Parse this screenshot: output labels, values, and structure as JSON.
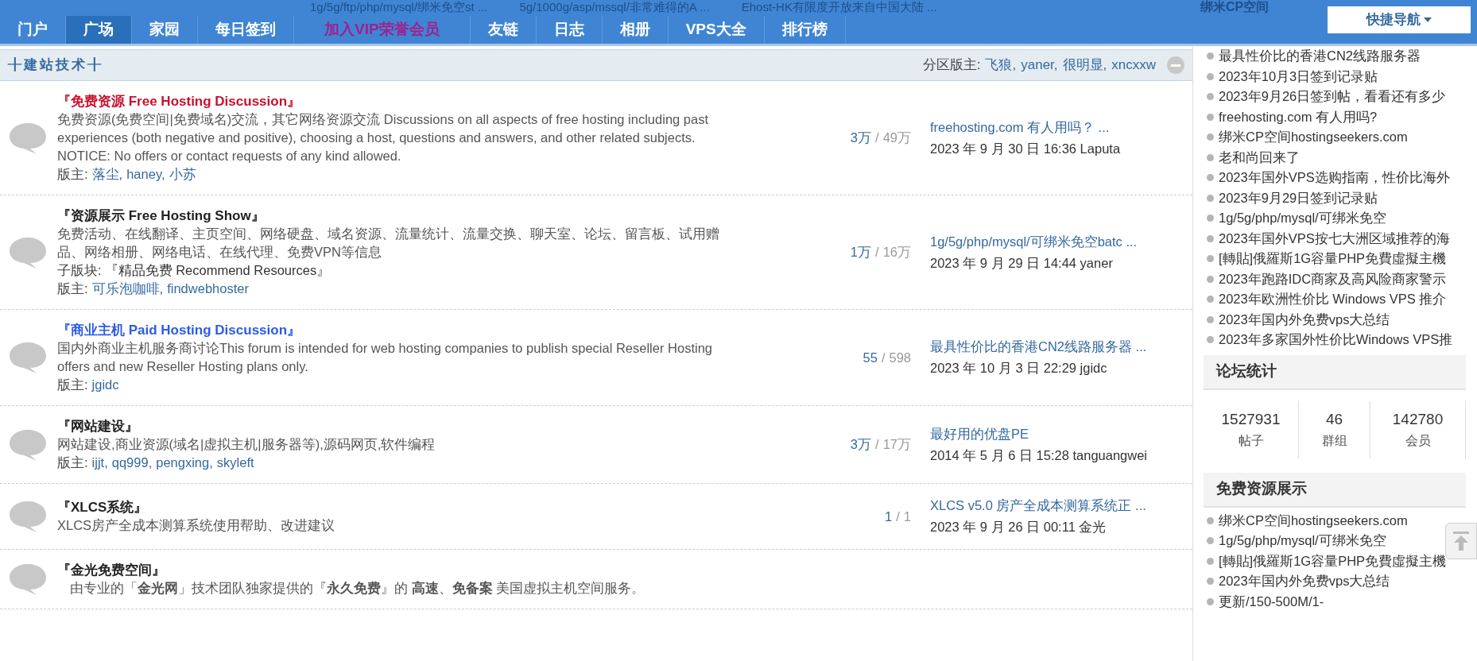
{
  "background_links": [
    "1g/5g/ftp/php/mysql/绑米免空st ...",
    "5g/1000g/asp/mssql/非常难得的A ...",
    "Ehost-HK有限度开放来自中国大陆 ..."
  ],
  "background_panel_title": "绑米CP空间",
  "nav": [
    {
      "label": "门户",
      "selected": false,
      "kind": "normal"
    },
    {
      "label": "广场",
      "selected": true,
      "kind": "normal"
    },
    {
      "label": "家园",
      "selected": false,
      "kind": "normal"
    },
    {
      "label": "每日签到",
      "selected": false,
      "kind": "normal"
    },
    {
      "label": "加入VIP荣誉会员",
      "selected": false,
      "kind": "vip"
    },
    {
      "label": "友链",
      "selected": false,
      "kind": "normal"
    },
    {
      "label": "日志",
      "selected": false,
      "kind": "normal"
    },
    {
      "label": "相册",
      "selected": false,
      "kind": "normal"
    },
    {
      "label": "VPS大全",
      "selected": false,
      "kind": "normal"
    },
    {
      "label": "排行榜",
      "selected": false,
      "kind": "normal"
    }
  ],
  "quick_nav": "快捷导航",
  "section": {
    "title": "╂建站技术╂",
    "moderators_label": "分区版主:",
    "moderators": [
      "飞狼,",
      "yaner,",
      "很明显,",
      "xncxxw"
    ],
    "collapsed": false
  },
  "forums": [
    {
      "title": "『免费资源 Free Hosting Discussion』",
      "color": "#c8102e",
      "description": "免费资源(免费空间|免费域名)交流，其它网络资源交流 Discussions on all aspects of free hosting including past experiences (both negative and positive), choosing a host, questions and answers, and other related subjects. NOTICE: No offers or contact requests of any kind allowed.",
      "moderators_label": "版主:",
      "moderators": [
        "落尘,",
        "haney,",
        "小苏"
      ],
      "threads": "3万",
      "separator": "/",
      "posts": "49万",
      "last_topic": "freehosting.com 有人用吗？ ...",
      "last_info": "2023 年 9 月 30 日 16:36 Laputa"
    },
    {
      "title": "『资源展示 Free Hosting Show』",
      "color": "#222222",
      "description": "免费活动、在线翻译、主页空间、网络硬盘、域名资源、流量统计、流量交换、聊天室、论坛、留言板、试用赠品、网络相册、网络电话、在线代理、免费VPN等信息",
      "subforum_label": "子版块:",
      "subforum": "『精品免费 Recommend Resources』",
      "moderators_label": "版主:",
      "moderators": [
        "可乐泡咖啡,",
        "findwebhoster"
      ],
      "threads": "1万",
      "separator": "/",
      "posts": "16万",
      "last_topic": "1g/5g/php/mysql/可绑米免空batc ...",
      "last_info": "2023 年 9 月 29 日 14:44 yaner"
    },
    {
      "title": "『商业主机 Paid Hosting Discussion』",
      "color": "#2b5bea",
      "description": "国内外商业主机服务商讨论This forum is intended for web hosting companies to publish special Reseller Hosting offers and new Reseller Hosting plans only.",
      "moderators_label": "版主:",
      "moderators": [
        "jgidc"
      ],
      "threads": "55",
      "separator": "/",
      "posts": "598",
      "last_topic": "最具性价比的香港CN2线路服务器 ...",
      "last_info": "2023 年 10 月 3 日 22:29 jgidc"
    },
    {
      "title": "『网站建设』",
      "color": "#222222",
      "description": "网站建设,商业资源(域名|虚拟主机|服务器等),源码网页,软件编程",
      "moderators_label": "版主:",
      "moderators": [
        "ijjt,",
        "qq999,",
        "pengxing,",
        "skyleft"
      ],
      "threads": "3万",
      "separator": "/",
      "posts": "17万",
      "last_topic": "最好用的优盘PE",
      "last_info": "2014 年 5 月 6 日 15:28 tanguangwei"
    },
    {
      "title": "『XLCS系统』",
      "color": "#222222",
      "description": "XLCS房产全成本测算系统使用帮助、改进建议",
      "threads": "1",
      "separator": "/",
      "posts": "1",
      "last_topic": "XLCS v5.0 房产全成本测算系统正 ...",
      "last_info": "2023 年 9 月 26 日 00:11 金光"
    },
    {
      "title": "『金光免费空间』",
      "color": "#222222",
      "description": "由专业的「**金光网**」技术团队独家提供的『**永久免费**』的 **高速**、**免备案** 美国虚拟主机空间服务。"
    }
  ],
  "sidebar": {
    "hot_links": [
      "最具性价比的香港CN2线路服务器",
      "2023年10月3日签到记录贴",
      "2023年9月26日签到帖，看看还有多少",
      "freehosting.com 有人用吗?",
      "绑米CP空间hostingseekers.com",
      "老和尚回来了",
      "2023年国外VPS选购指南，性价比海外",
      "2023年9月29日签到记录贴",
      "1g/5g/php/mysql/可绑米免空",
      "2023年国外VPS按七大洲区域推荐的海",
      "[轉貼]俄羅斯1G容量PHP免費虛擬主機",
      "2023年跑路IDC商家及高风险商家警示",
      "2023年欧洲性价比 Windows VPS 推介",
      "2023年国内外免费vps大总结",
      "2023年多家国外性价比Windows VPS推"
    ],
    "stats_title": "论坛统计",
    "stats": [
      {
        "value": "1527931",
        "label": "帖子"
      },
      {
        "value": "46",
        "label": "群组"
      },
      {
        "value": "142780",
        "label": "会员"
      }
    ],
    "showcase_title": "免费资源展示",
    "showcase_links": [
      "绑米CP空间hostingseekers.com",
      "1g/5g/php/mysql/可绑米免空",
      "[轉貼]俄羅斯1G容量PHP免費虛擬主機",
      "2023年国内外免费vps大总结",
      "更新/150-500M/1-"
    ]
  }
}
